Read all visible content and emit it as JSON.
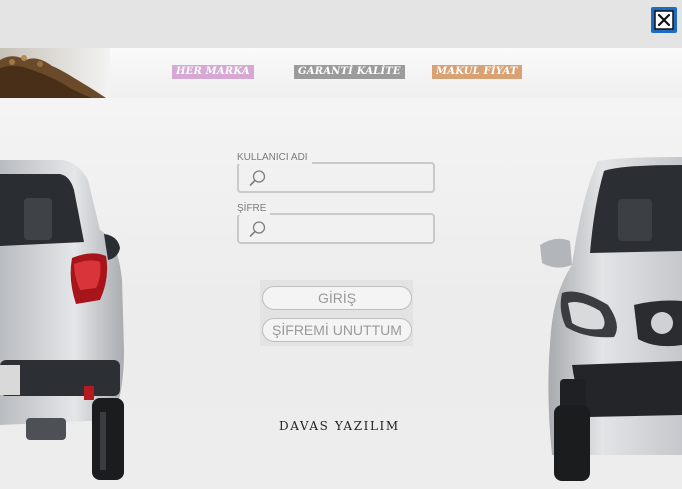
{
  "window": {
    "close_icon": "close-icon"
  },
  "banner": {
    "badges": [
      "HER MARKA",
      "GARANTİ KALİTE",
      "MAKUL FİYAT"
    ],
    "badge_colors": [
      "#d6a9d4",
      "#9b9b9b",
      "#d8a274"
    ]
  },
  "login": {
    "username_label": "KULLANICI ADI",
    "username_value": "",
    "password_label": "ŞİFRE",
    "password_value": "",
    "login_button": "GİRİŞ",
    "forgot_button": "ŞİFREMİ UNUTTUM"
  },
  "footer": {
    "brand": "DAVAS YAZILIM"
  },
  "colors": {
    "close_button_bg": "#1c6cc4"
  }
}
